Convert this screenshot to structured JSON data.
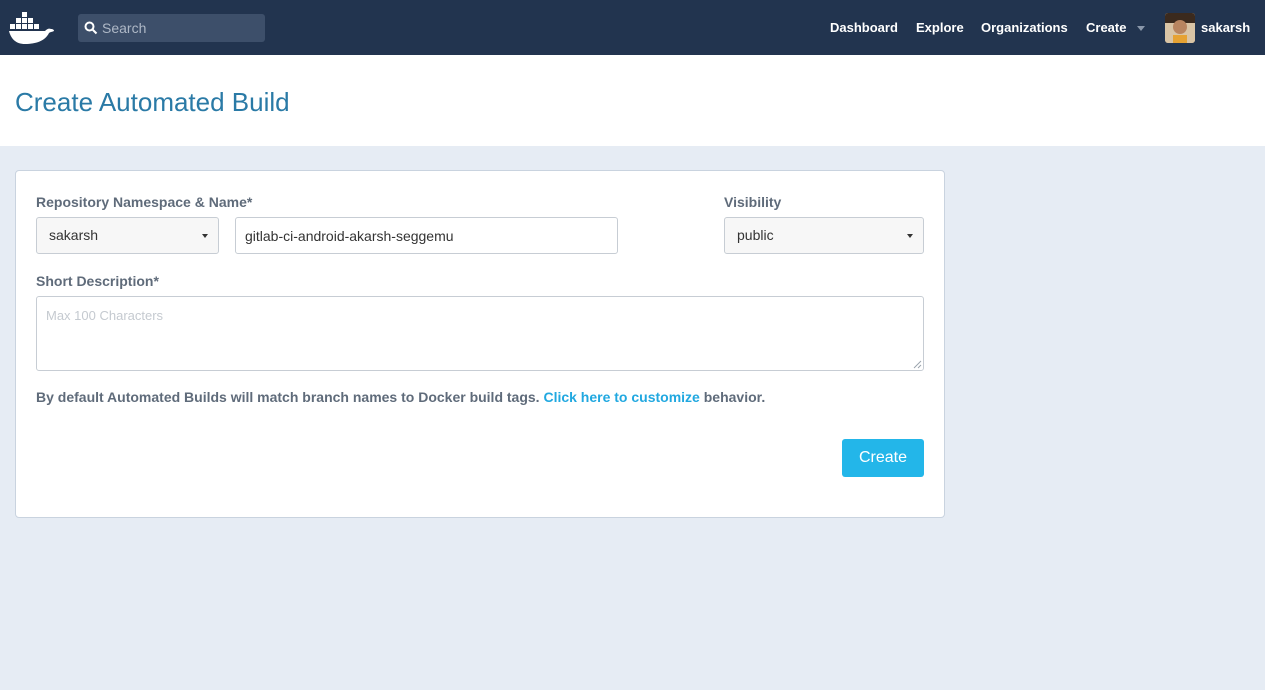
{
  "colors": {
    "topbar": "#22344f",
    "accent": "#23b6e9",
    "title": "#2a7aa6",
    "link": "#21a8e0",
    "background": "#e6ecf4"
  },
  "header": {
    "logo_icon": "docker-whale-icon",
    "search": {
      "placeholder": "Search",
      "icon": "search-icon"
    },
    "nav": {
      "dashboard": "Dashboard",
      "explore": "Explore",
      "organizations": "Organizations",
      "create": "Create"
    },
    "user": {
      "name": "sakarsh",
      "avatar_icon": "user-avatar"
    }
  },
  "page": {
    "title": "Create Automated Build"
  },
  "form": {
    "repo_label": "Repository Namespace & Name*",
    "namespace_value": "sakarsh",
    "repo_name_value": "gitlab-ci-android-akarsh-seggemu",
    "visibility_label": "Visibility",
    "visibility_value": "public",
    "description_label": "Short Description*",
    "description_placeholder": "Max 100 Characters",
    "note_prefix": "By default Automated Builds will match branch names to Docker build tags.",
    "note_link": "Click here to customize",
    "note_suffix": "behavior.",
    "submit_label": "Create"
  }
}
